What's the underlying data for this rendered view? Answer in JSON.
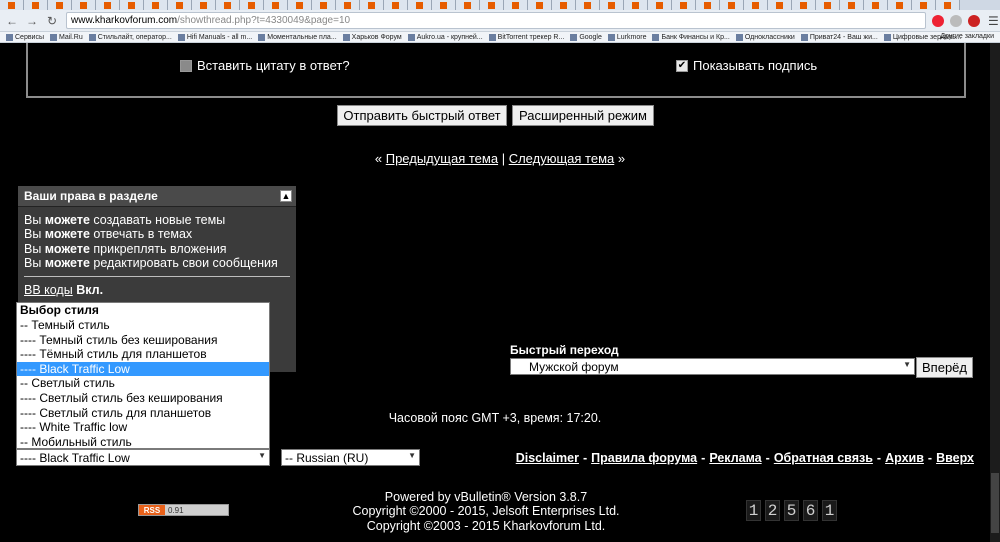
{
  "browser": {
    "url_host": "www.kharkovforum.com",
    "url_path": "/showthread.php?t=4330049&page=10",
    "bookmarks": [
      "Сервисы",
      "Mail.Ru",
      "Стильлайт, оператор...",
      "Hifi Manuals - all m...",
      "Моментальные пла...",
      "Харьков Форум",
      "Aukro.ua - крупней...",
      "BitTorrent трекер R...",
      "Google",
      "Lurkmore",
      "Банк Финансы и Кр...",
      "Одноклассники",
      "Приват24 - Ваш жи...",
      "Цифровые зеркаль..."
    ],
    "other_bookmarks": "Другие закладки"
  },
  "reply": {
    "quote_label": "Вставить цитату в ответ?",
    "signature_label": "Показывать подпись",
    "quick_reply_button": "Отправить быстрый ответ",
    "advanced_button": "Расширенный режим"
  },
  "thread_nav": {
    "prev": "Предыдущая тема",
    "next": "Следующая тема",
    "left_quote": "«",
    "right_quote": "»",
    "divider": "|"
  },
  "permissions": {
    "title": "Ваши права в разделе",
    "lines": [
      {
        "pre": "Вы ",
        "bold": "можете",
        "post": " создавать новые темы"
      },
      {
        "pre": "Вы ",
        "bold": "можете",
        "post": " отвечать в темах"
      },
      {
        "pre": "Вы ",
        "bold": "можете",
        "post": " прикреплять вложения"
      },
      {
        "pre": "Вы ",
        "bold": "можете",
        "post": " редактировать свои сообщения"
      }
    ],
    "bbcode_link": "BB коды",
    "bbcode_state": "Вкл."
  },
  "style_chooser": {
    "group_label": "Выбор стиля",
    "options": [
      "-- Темный стиль",
      "---- Темный стиль без кеширования",
      "---- Тёмный стиль для планшетов",
      "---- Black Traffic Low",
      "-- Светлый стиль",
      "---- Светлый стиль без кеширования",
      "---- Светлый стиль для планшетов",
      "---- White Traffic low",
      "-- Мобильный стиль"
    ],
    "selected": "---- Black Traffic Low"
  },
  "language_select": "-- Russian (RU)",
  "quick_nav": {
    "label": "Быстрый переход",
    "selected": "Мужской форум",
    "go_button": "Вперёд"
  },
  "timezone": "Часовой пояс GMT +3, время: 17:20.",
  "footer_links": [
    "Disclaimer",
    "Правила форума",
    "Реклама",
    "Обратная связь",
    "Архив",
    "Вверх"
  ],
  "credits": [
    "Powered by vBulletin® Version 3.8.7",
    "Copyright ©2000 - 2015, Jelsoft Enterprises Ltd.",
    "Copyright ©2003 - 2015 Kharkovforum Ltd."
  ],
  "rss": {
    "tag": "RSS",
    "value": "0.91"
  },
  "counter_digits": [
    "1",
    "2",
    "5",
    "6",
    "1"
  ]
}
